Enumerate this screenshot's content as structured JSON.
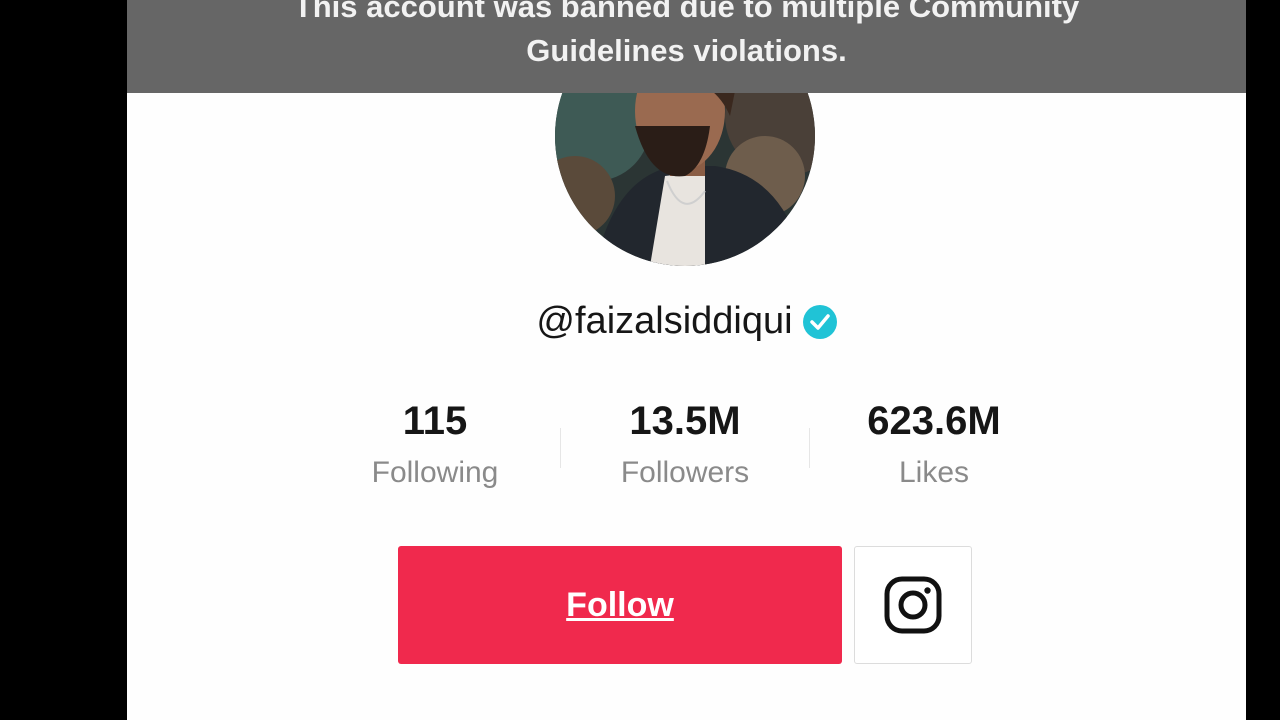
{
  "banner": {
    "line1": "This account was banned due to multiple Community",
    "line2": "Guidelines violations."
  },
  "profile": {
    "username": "@faizalsiddiqui",
    "verified_icon": "verified-badge-icon"
  },
  "stats": [
    {
      "value": "115",
      "label": "Following"
    },
    {
      "value": "13.5M",
      "label": "Followers"
    },
    {
      "value": "623.6M",
      "label": "Likes"
    }
  ],
  "actions": {
    "follow_label": "Follow",
    "instagram_icon": "instagram-icon"
  },
  "colors": {
    "follow_button": "#f0294d",
    "verified_badge": "#20c3d6",
    "banner_bg": "#666666"
  }
}
